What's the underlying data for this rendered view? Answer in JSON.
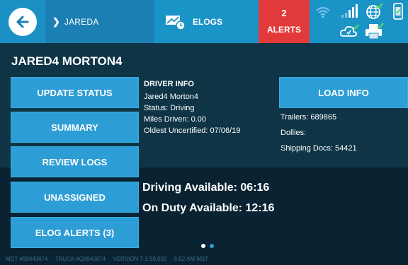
{
  "header": {
    "driver_tab": "JAREDA",
    "elogs_label": "ELOGS",
    "alerts_count": "2",
    "alerts_label": "ALERTS",
    "icons": [
      "back-arrow-icon",
      "chevron-right-icon",
      "elogs-truck-clock-icon",
      "wifi-signal-icon",
      "cell-signal-icon",
      "globe-check-icon",
      "phone-icon",
      "cloud-check-icon",
      "printer-check-icon"
    ]
  },
  "main": {
    "driver_name": "JARED4 MORTON4",
    "menu": [
      {
        "label": "UPDATE STATUS"
      },
      {
        "label": "SUMMARY"
      },
      {
        "label": "REVIEW LOGS"
      },
      {
        "label": "UNASSIGNED"
      },
      {
        "label": "ELOG ALERTS (3)"
      }
    ],
    "driver_info": {
      "heading": "DRIVER INFO",
      "name": "Jared4 Morton4",
      "status": "Status: Driving",
      "miles": "Miles Driven: 0.00",
      "oldest": "Oldest Uncertified: 07/06/19"
    },
    "load_info": {
      "button_label": "LOAD INFO",
      "trailers": "Trailers: 689865",
      "dollies": "Dollies:",
      "shipping": "Shipping Docs: 54421"
    },
    "availability": {
      "driving": "Driving Available: 06:16",
      "on_duty": "On Duty Available: 12:16"
    },
    "pager": {
      "pages": 2,
      "active": 1
    }
  },
  "footer": {
    "mdt": "MDT #99943874",
    "truck": "TRUCK #Q9943874",
    "version": "VERSION 7.1.59.002",
    "time": "5:52 AM MST"
  },
  "colors": {
    "topbar": "#1a93c7",
    "driver_tab": "#1c7fb4",
    "alerts": "#e23a3a",
    "panel": "#0e3446",
    "button": "#2d9dd5",
    "check_green": "#4cd964"
  }
}
